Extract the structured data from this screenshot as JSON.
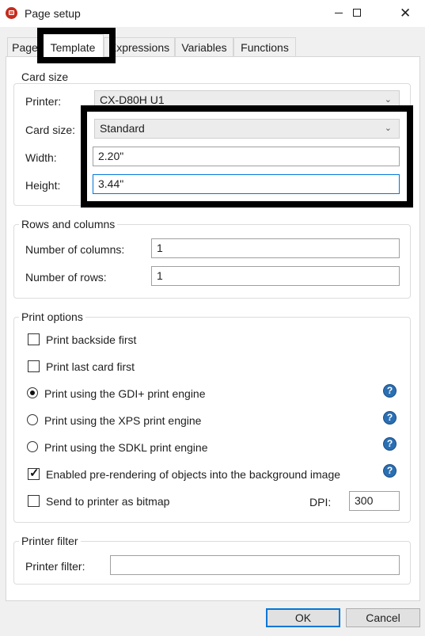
{
  "window": {
    "title": "Page setup"
  },
  "tabs": [
    {
      "label": "Page"
    },
    {
      "label": "Template"
    },
    {
      "label": "Expressions"
    },
    {
      "label": "Variables"
    },
    {
      "label": "Functions"
    }
  ],
  "card_size": {
    "group_title": "Card size",
    "printer_label": "Printer:",
    "printer_value": "CX-D80H U1",
    "card_size_label": "Card size:",
    "card_size_value": "Standard",
    "width_label": "Width:",
    "width_value": "2.20\"",
    "height_label": "Height:",
    "height_value": "3.44\""
  },
  "rows_columns": {
    "group_title": "Rows and columns",
    "columns_label": "Number of columns:",
    "columns_value": "1",
    "rows_label": "Number of rows:",
    "rows_value": "1"
  },
  "print_options": {
    "group_title": "Print options",
    "backside_first": {
      "label": "Print backside first",
      "checked": false
    },
    "last_card_first": {
      "label": "Print last card first",
      "checked": false
    },
    "gdi_engine": {
      "label": "Print using the GDI+ print engine",
      "selected": true
    },
    "xps_engine": {
      "label": "Print using the XPS print engine",
      "selected": false
    },
    "sdkl_engine": {
      "label": "Print using the SDKL print engine",
      "selected": false
    },
    "prerendering": {
      "label": "Enabled pre-rendering of objects into the background image",
      "checked": true
    },
    "bitmap": {
      "label": "Send to printer as bitmap",
      "checked": false
    },
    "dpi_label": "DPI:",
    "dpi_value": "300",
    "help_glyph": "?"
  },
  "printer_filter": {
    "group_title": "Printer filter",
    "label": "Printer filter:",
    "value": ""
  },
  "buttons": {
    "ok": "OK",
    "cancel": "Cancel"
  },
  "icons": {
    "app": "app-printer-icon",
    "minimize": "minimize-icon",
    "maximize": "maximize-icon",
    "close": "close-icon",
    "close_glyph": "✕",
    "chevron_glyph": "⌄",
    "check_glyph": "✓"
  },
  "colors": {
    "focus_border": "#0078d7",
    "help_blue": "#2b6fb3",
    "annotation": "#000000"
  }
}
